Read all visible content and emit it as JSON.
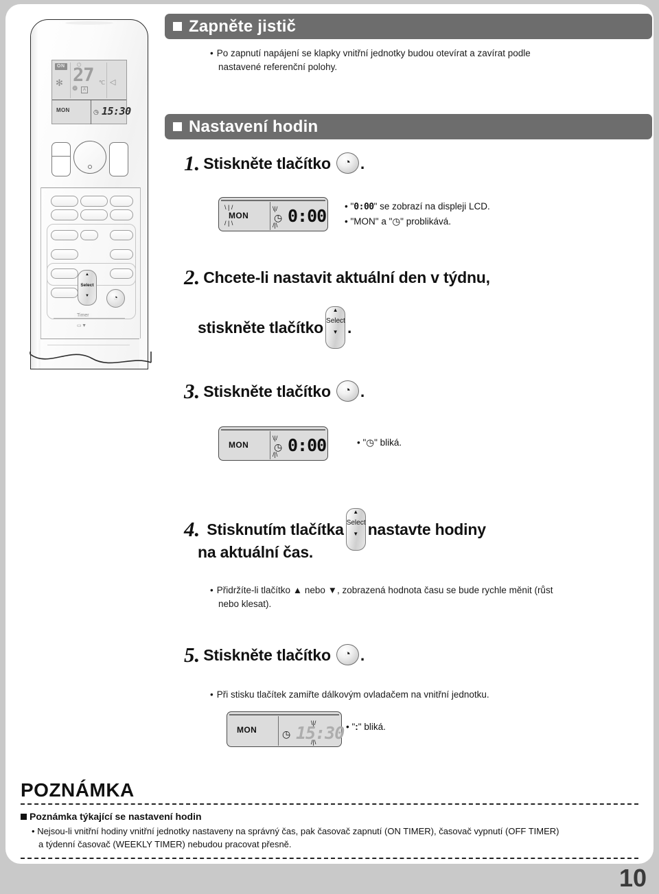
{
  "page": {
    "number": "10"
  },
  "remote": {
    "lcd": {
      "on_label": "ON",
      "snow_icon": "✻",
      "temperature": "27",
      "unit": "℃",
      "fan_icon": "❁",
      "auto_label": "A",
      "swing_icon": "◁",
      "day": "MON",
      "clock_icon": "◷",
      "time": "15:30"
    },
    "select_button": {
      "up": "▲",
      "label": "Select",
      "down": "▼"
    },
    "clock_button_icon": "◔",
    "timer_label": "Timer",
    "battery_icon": "▭▼"
  },
  "sections": [
    {
      "title": "Zapněte jistič",
      "bullets": [
        "Po zapnutí napájení se klapky vnitřní jednotky budou otevírat a zavírat podle",
        "nastavené referenční polohy."
      ]
    },
    {
      "title": "Nastavení hodin"
    }
  ],
  "steps": [
    {
      "num": "1.",
      "text_before": "Stiskněte tlačítko",
      "text_after": ".",
      "lcd": {
        "day": "MON",
        "clock_icon": "◷",
        "time": "0:00"
      },
      "notes": [
        {
          "pre": "\"",
          "code": "0:00",
          "post": "\" se zobrazí na displeji LCD."
        },
        {
          "pre": "\"MON\" a \"",
          "code": "◷",
          "post": "\" problikává."
        }
      ]
    },
    {
      "num": "2.",
      "line1": "Chcete-li nastavit aktuální den v týdnu,",
      "line2_before": "stiskněte tlačítko",
      "line2_after": "."
    },
    {
      "num": "3.",
      "text_before": "Stiskněte tlačítko",
      "text_after": ".",
      "lcd": {
        "day": "MON",
        "clock_icon": "◷",
        "time": "0:00"
      },
      "note": {
        "pre": "\"",
        "code": "◷",
        "post": "\" bliká."
      }
    },
    {
      "num": "4.",
      "line1_before": "Stisknutím tlačítka",
      "line1_after": "nastavte hodiny",
      "line2": "na aktuální čas.",
      "bullets": [
        "Přidržíte-li tlačítko ▲ nebo ▼, zobrazená hodnota času se bude rychle měnit (růst",
        "nebo klesat)."
      ]
    },
    {
      "num": "5.",
      "text_before": "Stiskněte tlačítko",
      "text_after": ".",
      "bullet": "Při stisku tlačítek zamiřte dálkovým ovladačem na vnitřní jednotku.",
      "lcd": {
        "day": "MON",
        "clock_icon": "◷",
        "time": "15:30"
      },
      "note": {
        "pre": "\"",
        "code": ":",
        "post": "\" bliká."
      }
    }
  ],
  "poznamka": {
    "title": "POZNÁMKA",
    "heading": "Poznámka týkající se nastavení hodin",
    "body_line1": "Nejsou-li vnitřní hodiny vnitřní jednotky nastaveny na správný čas, pak časovač zapnutí (ON TIMER), časovač vypnutí (OFF TIMER)",
    "body_line2": "a týdenní časovač (WEEKLY TIMER) nebudou pracovat přesně."
  },
  "colors": {
    "section_bar": "#6d6d6d",
    "page_background": "#c9c9c9",
    "sheet": "#ffffff",
    "lcd": "#dcdcdc",
    "text": "#111111"
  }
}
